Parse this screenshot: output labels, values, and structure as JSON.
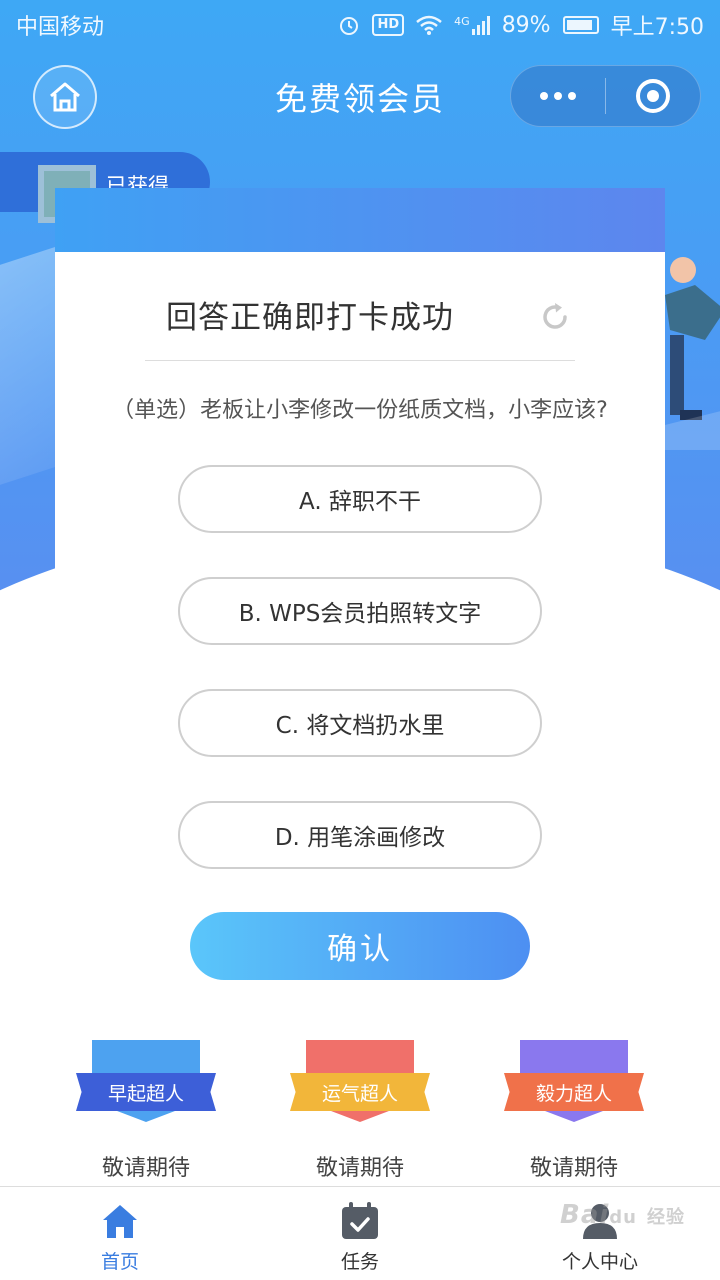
{
  "status_bar": {
    "carrier": "中国移动",
    "hd": "HD",
    "network": "4G",
    "battery": "89%",
    "battery_level": 0.89,
    "time": "早上7:50"
  },
  "nav": {
    "title": "免费领会员"
  },
  "profile": {
    "earned_text": "已获得"
  },
  "quiz": {
    "title": "回答正确即打卡成功",
    "question": "（单选）老板让小李修改一份纸质文档，小李应该?",
    "options": [
      {
        "label": "A. 辞职不干"
      },
      {
        "label": "B. WPS会员拍照转文字"
      },
      {
        "label": "C. 将文档扔水里"
      },
      {
        "label": "D. 用笔涂画修改"
      }
    ],
    "confirm_label": "确认"
  },
  "badges": [
    {
      "name": "早起超人",
      "caption": "敬请期待",
      "ribbon_color": "#3d5fd8",
      "shield_color": "#4da2f0"
    },
    {
      "name": "运气超人",
      "caption": "敬请期待",
      "ribbon_color": "#f2b63a",
      "shield_color": "#f0706a"
    },
    {
      "name": "毅力超人",
      "caption": "敬请期待",
      "ribbon_color": "#f0714a",
      "shield_color": "#8a78ee"
    }
  ],
  "tabbar": {
    "items": [
      {
        "label": "首页",
        "icon": "home-icon",
        "active": true
      },
      {
        "label": "任务",
        "icon": "calendar-check-icon",
        "active": false
      },
      {
        "label": "个人中心",
        "icon": "user-icon",
        "active": false
      }
    ]
  },
  "watermark": {
    "text": "Bai",
    "suffix": "du",
    "cn": "经验"
  },
  "colors": {
    "primary": "#4a9cf4",
    "active_tab": "#3a7de0",
    "confirm_start": "#5ac6fa",
    "confirm_end": "#4d8ff2"
  }
}
